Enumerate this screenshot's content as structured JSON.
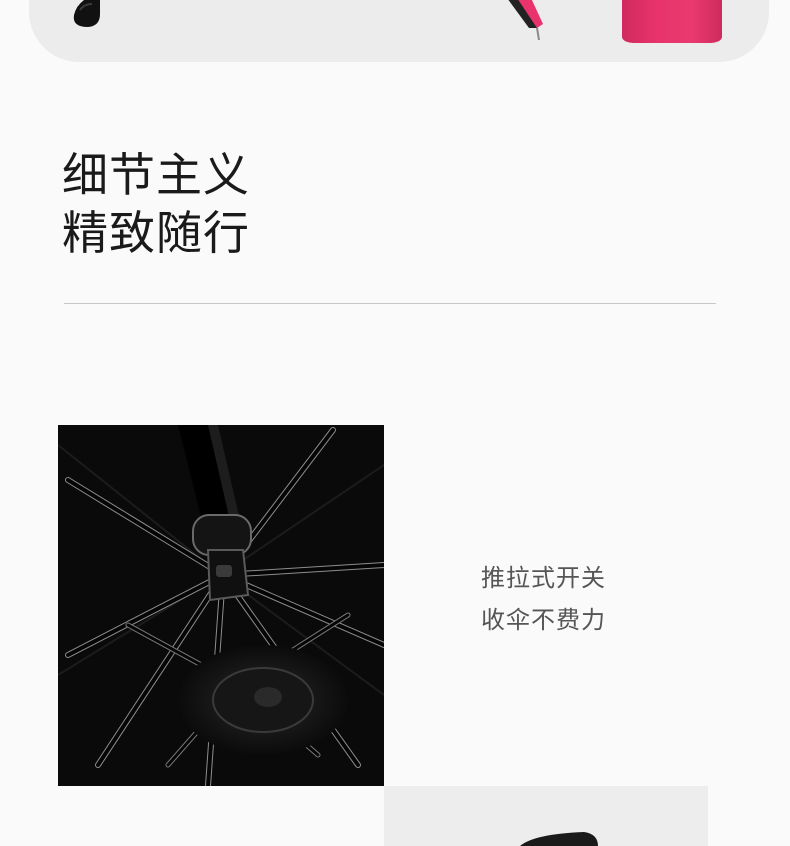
{
  "headline": {
    "line1": "细节主义",
    "line2": "精致随行"
  },
  "feature": {
    "line1": "推拉式开关",
    "line2": "收伞不费力"
  },
  "colors": {
    "background": "#fafafa",
    "card": "#ececec",
    "umbrella_pink": "#e8336c",
    "canopy": "#0b0b0b",
    "feature_text": "#555555",
    "headline_text": "#1a1a1a"
  }
}
